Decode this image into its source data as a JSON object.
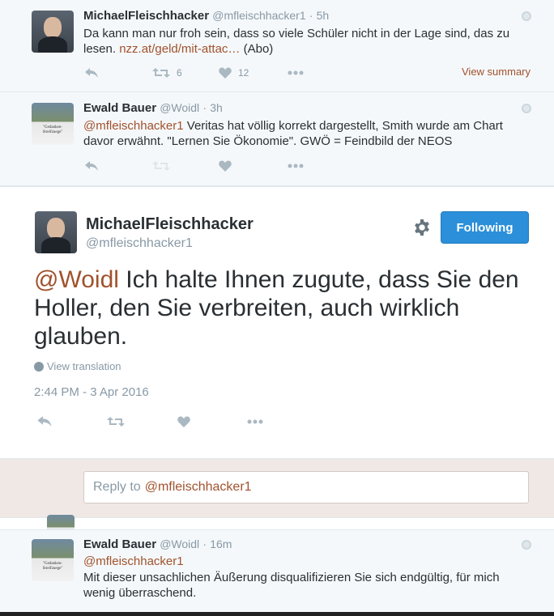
{
  "tweet1": {
    "name": "MichaelFleischhacker",
    "handle": "@mfleischhacker1",
    "dot": "·",
    "time": "5h",
    "text_before_link": "Da kann man nur froh sein, dass so viele Schüler nicht in der Lage sind, das zu lesen. ",
    "link": "nzz.at/geld/mit-attac…",
    "text_after_link": " (Abo)",
    "retweets": "6",
    "likes": "12",
    "view_summary": "View summary"
  },
  "tweet2": {
    "name": "Ewald Bauer",
    "handle": "@Woidl",
    "dot": "·",
    "time": "3h",
    "mention": "@mfleischhacker1",
    "text": " Veritas hat völlig korrekt dargestellt, Smith wurde am Chart davor erwähnt. \"Lernen Sie Ökonomie\". GWÖ = Feindbild der NEOS"
  },
  "main": {
    "name": "MichaelFleischhacker",
    "handle": "@mfleischhacker1",
    "follow_label": "Following",
    "mention": "@Woidl",
    "text": " Ich halte Ihnen zugute, dass Sie den Holler, den Sie  verbreiten, auch wirklich glauben.",
    "translate_label": "View translation",
    "timestamp": "2:44 PM - 3 Apr 2016"
  },
  "reply": {
    "placeholder_prefix": "Reply to",
    "placeholder_mention": "@mfleischhacker1"
  },
  "tweet3": {
    "name": "Ewald Bauer",
    "handle": "@Woidl",
    "dot": "·",
    "time": "16m",
    "mention": "@mfleischhacker1",
    "text": "Mit dieser unsachlichen Äußerung disqualifizieren Sie sich endgültig, für mich wenig überraschend."
  },
  "icons": {
    "reply": "reply-icon",
    "retweet": "retweet-icon",
    "like": "heart-icon",
    "more": "more-icon",
    "globe": "globe-icon",
    "gear": "gear-icon"
  },
  "colors": {
    "link": "#a0522d",
    "follow_button": "#2b8fd9",
    "muted": "#8899a6"
  }
}
